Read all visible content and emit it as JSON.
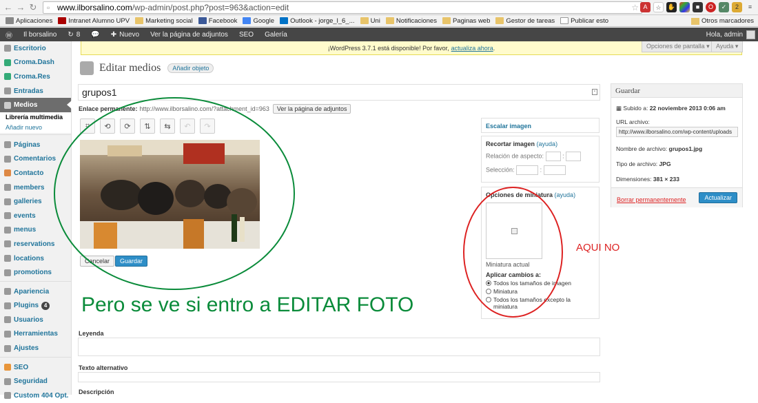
{
  "browser": {
    "url_host": "www.ilborsalino.com",
    "url_path": "/wp-admin/post.php?post=963&action=edit",
    "bookmarks": [
      "Aplicaciones",
      "Intranet Alumno UPV",
      "Marketing social",
      "Facebook",
      "Google",
      "Outlook - jorge_l_6_...",
      "Uni",
      "Notificaciones",
      "Paginas web",
      "Gestor de tareas",
      "Publicar esto"
    ],
    "other_bookmarks": "Otros marcadores"
  },
  "adminbar": {
    "site": "Il borsalino",
    "updates": "8",
    "new": "Nuevo",
    "view": "Ver la página de adjuntos",
    "seo": "SEO",
    "gallery": "Galería",
    "greeting": "Hola, admin"
  },
  "sidebar": {
    "items": [
      {
        "label": "Escritorio"
      },
      {
        "label": "Croma.Dash"
      },
      {
        "label": "Croma.Res"
      },
      {
        "label": "Entradas"
      },
      {
        "label": "Medios"
      }
    ],
    "sub": [
      "Librería multimedia",
      "Añadir nuevo"
    ],
    "items2": [
      {
        "label": "Páginas"
      },
      {
        "label": "Comentarios"
      },
      {
        "label": "Contacto"
      },
      {
        "label": "members"
      },
      {
        "label": "galleries"
      },
      {
        "label": "events"
      },
      {
        "label": "menus"
      },
      {
        "label": "reservations"
      },
      {
        "label": "locations"
      },
      {
        "label": "promotions"
      }
    ],
    "items3": [
      {
        "label": "Apariencia"
      },
      {
        "label": "Plugins",
        "badge": "4"
      },
      {
        "label": "Usuarios"
      },
      {
        "label": "Herramientas"
      },
      {
        "label": "Ajustes"
      }
    ],
    "items4": [
      {
        "label": "SEO"
      },
      {
        "label": "Seguridad"
      },
      {
        "label": "Custom 404 Opt."
      }
    ]
  },
  "notice": {
    "text": "¡WordPress 3.7.1 está disponible! Por favor,",
    "link": "actualiza ahora",
    "end": "."
  },
  "screen_options": "Opciones de pantalla",
  "help": "Ayuda",
  "page": {
    "title": "Editar medios",
    "add_new": "Añadir objeto",
    "post_title": "grupos1",
    "permalink_label": "Enlace permanente:",
    "permalink_url": "http://www.ilborsalino.com/?attachment_id=963",
    "view_attach_btn": "Ver la página de adjuntos"
  },
  "editor": {
    "cancel": "Cancelar",
    "save": "Guardar",
    "scale_title": "Escalar imagen",
    "crop_title": "Recortar imagen",
    "help_link": "(ayuda)",
    "aspect_label": "Relación de aspecto:",
    "selection_label": "Selección:",
    "colon": ":",
    "thumb_title": "Opciones de miniatura",
    "thumb_current": "Miniatura actual",
    "apply_label": "Aplicar cambios a:",
    "options": [
      "Todos los tamaños de imagen",
      "Miniatura",
      "Todos los tamaños excepto la miniatura"
    ]
  },
  "annotations": {
    "green": "Pero se ve si entro a EDITAR FOTO",
    "red": "AQUI NO"
  },
  "save_box": {
    "title": "Guardar",
    "uploaded_label": "Subido a:",
    "uploaded_value": "22 noviembre 2013 0:06 am",
    "url_label": "URL archivo:",
    "url_value": "http://www.ilborsalino.com/wp-content/uploads",
    "filename_label": "Nombre de archivo:",
    "filename_value": "grupos1.jpg",
    "filetype_label": "Tipo de archivo:",
    "filetype_value": "JPG",
    "dimensions_label": "Dimensiones:",
    "dimensions_value": "381 × 233",
    "delete": "Borrar permanentemente",
    "update": "Actualizar"
  },
  "fields": {
    "caption": "Leyenda",
    "alt": "Texto alternativo",
    "description": "Descripción"
  }
}
